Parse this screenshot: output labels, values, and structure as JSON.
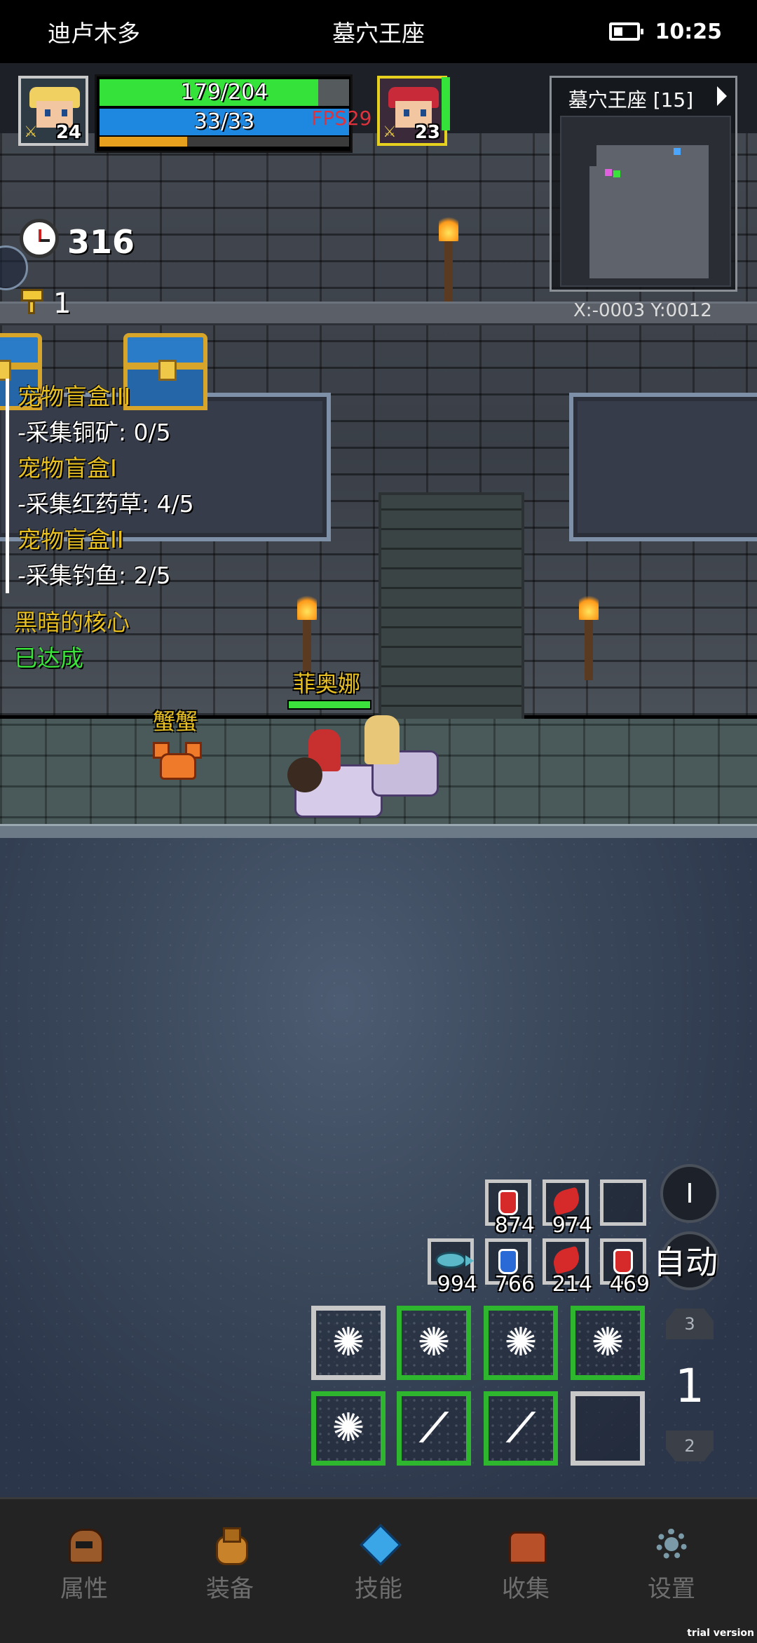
{
  "status_bar": {
    "location": "迪卢木多",
    "map_name": "墓穴王座",
    "time": "10:25"
  },
  "player": {
    "level": "24",
    "hp_text": "179/204",
    "hp_fraction": 0.877,
    "mp_text": "33/33",
    "mp_fraction": 1.0,
    "xp_fraction": 0.35,
    "fps": "FPS29"
  },
  "companion": {
    "level": "23",
    "hp_fraction": 1.0
  },
  "minimap": {
    "title": "墓穴王座 [15]",
    "coords": "X:-0003  Y:0012"
  },
  "counters": {
    "timer": "316",
    "keys": "1"
  },
  "quests": [
    {
      "text": "宠物盲盒III",
      "color": "yellow"
    },
    {
      "text": "-采集铜矿: 0/5",
      "color": "white"
    },
    {
      "text": "宠物盲盒I",
      "color": "yellow"
    },
    {
      "text": "-采集红药草: 4/5",
      "color": "white"
    },
    {
      "text": "宠物盲盒II",
      "color": "yellow"
    },
    {
      "text": "-采集钓鱼: 2/5",
      "color": "white"
    },
    {
      "text": "黑暗的核心",
      "color": "yellow"
    },
    {
      "text": "已达成",
      "color": "green"
    }
  ],
  "characters": {
    "hero_name": "菲奥娜",
    "hero_hp_fraction": 1.0,
    "enemy_name": "蟹蟹"
  },
  "items": {
    "row1": [
      {
        "icon": "red-potion-icon",
        "count": "874"
      },
      {
        "icon": "red-herb-icon",
        "count": "974"
      },
      {
        "icon": "empty-slot",
        "count": ""
      }
    ],
    "row2": [
      {
        "icon": "fish-icon",
        "count": "994"
      },
      {
        "icon": "blue-potion-icon",
        "count": "766"
      },
      {
        "icon": "red-herb-icon",
        "count": "214"
      },
      {
        "icon": "red-potion-icon",
        "count": "469"
      }
    ]
  },
  "controls": {
    "auto_label": "自动",
    "pause_label": "I",
    "page_up": "3",
    "page_current": "1",
    "page_down": "2"
  },
  "nav": [
    {
      "label": "属性",
      "icon": "helmet-icon"
    },
    {
      "label": "装备",
      "icon": "bag-icon"
    },
    {
      "label": "技能",
      "icon": "gem-icon"
    },
    {
      "label": "收集",
      "icon": "chest-icon"
    },
    {
      "label": "设置",
      "icon": "gear-icon"
    }
  ],
  "watermark": "trial version",
  "colors": {
    "hp": "#35e23a",
    "mp": "#1e88e0",
    "xp": "#e6a01e",
    "skill_active": "#2fb62f",
    "quest_title": "#e8c020",
    "quest_done": "#3ce23c",
    "fps": "#e0323c"
  }
}
